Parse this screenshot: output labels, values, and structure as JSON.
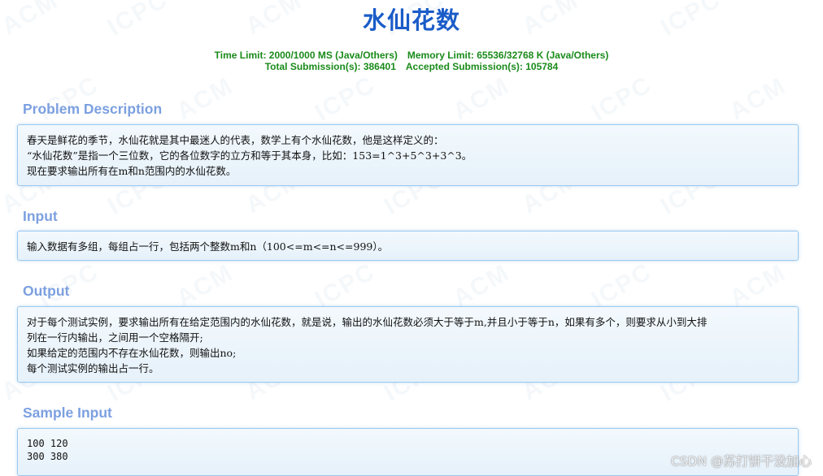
{
  "page": {
    "title": "水仙花数",
    "limits": {
      "time_limit": "Time Limit: 2000/1000 MS (Java/Others)",
      "memory_limit": "Memory Limit: 65536/32768 K (Java/Others)",
      "total_submissions": "Total Submission(s): 386401",
      "accepted_submissions": "Accepted Submission(s): 105784"
    }
  },
  "sections": {
    "description": {
      "heading": "Problem Description",
      "lines": [
        "春天是鲜花的季节，水仙花就是其中最迷人的代表，数学上有个水仙花数，他是这样定义的：",
        "“水仙花数”是指一个三位数，它的各位数字的立方和等于其本身，比如：153=1^3+5^3+3^3。",
        "现在要求输出所有在m和n范围内的水仙花数。"
      ]
    },
    "input": {
      "heading": "Input",
      "lines": [
        "输入数据有多组，每组占一行，包括两个整数m和n（100<=m<=n<=999）。"
      ]
    },
    "output": {
      "heading": "Output",
      "lines": [
        "对于每个测试实例，要求输出所有在给定范围内的水仙花数，就是说，输出的水仙花数必须大于等于m,并且小于等于n，如果有多个，则要求从小到大排",
        "列在一行内输出，之间用一个空格隔开;",
        "如果给定的范围内不存在水仙花数，则输出no;",
        "每个测试实例的输出占一行。"
      ]
    },
    "sample_input": {
      "heading": "Sample Input",
      "lines": [
        "100 120",
        "300 380"
      ]
    }
  },
  "watermark": {
    "csdn_label": "CSDN @苏打饼干没加心",
    "pattern_words": [
      "ACM",
      "ICPC"
    ]
  },
  "colors": {
    "title": "#1a5cc8",
    "limits": "#1a8b1a",
    "section_heading": "#7ca0e0",
    "panel_border": "#9cc8ee",
    "panel_bg": "#eaf3fb"
  }
}
